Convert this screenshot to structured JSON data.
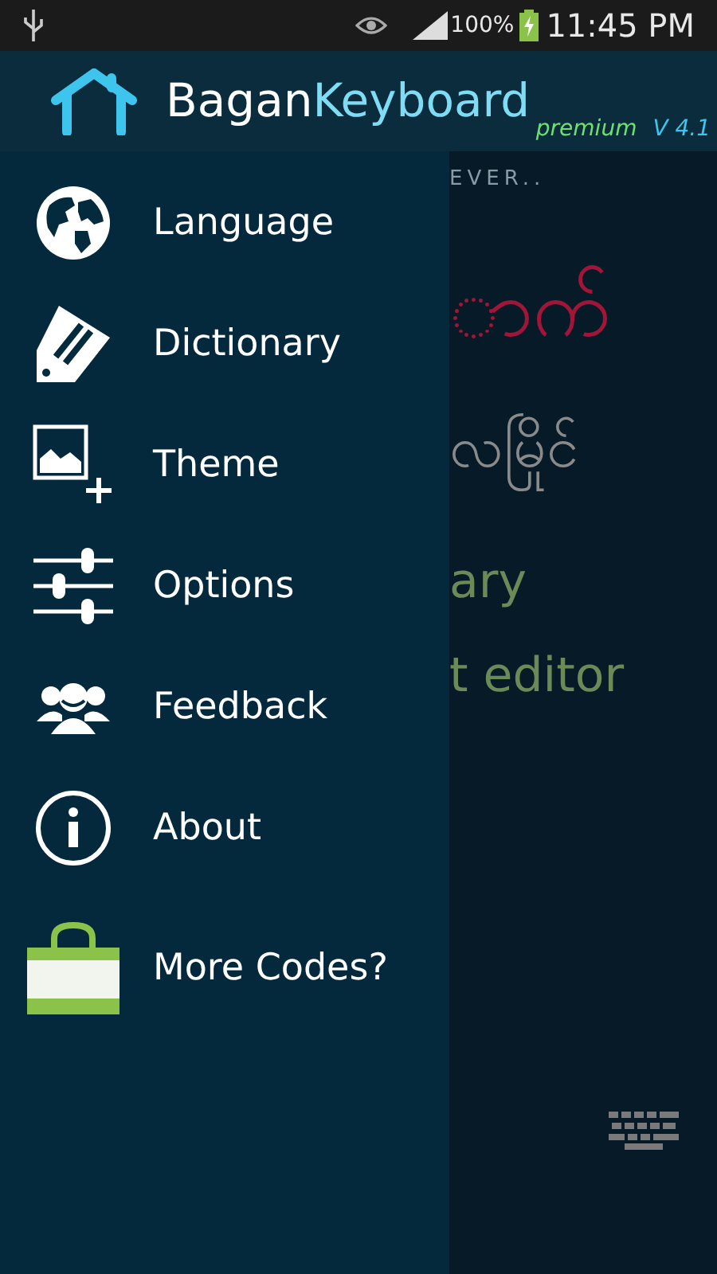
{
  "status_bar": {
    "battery": "100%",
    "time": "11:45 PM"
  },
  "header": {
    "title_first": "Bagan",
    "title_second": "Keyboard",
    "edition": "premium",
    "version": "V 4.1"
  },
  "drawer": {
    "items": [
      {
        "kind": "globe",
        "label": "Language"
      },
      {
        "kind": "tag",
        "label": "Dictionary"
      },
      {
        "kind": "image",
        "label": "Theme"
      },
      {
        "kind": "sliders",
        "label": "Options"
      },
      {
        "kind": "people",
        "label": "Feedback"
      },
      {
        "kind": "info",
        "label": "About"
      },
      {
        "kind": "bag",
        "label": "More Codes?"
      }
    ]
  },
  "background": {
    "tagline": "EVER..",
    "heading": "ာက်",
    "subheading": "လမြိုင်",
    "lines": [
      "ary",
      "t editor"
    ]
  }
}
